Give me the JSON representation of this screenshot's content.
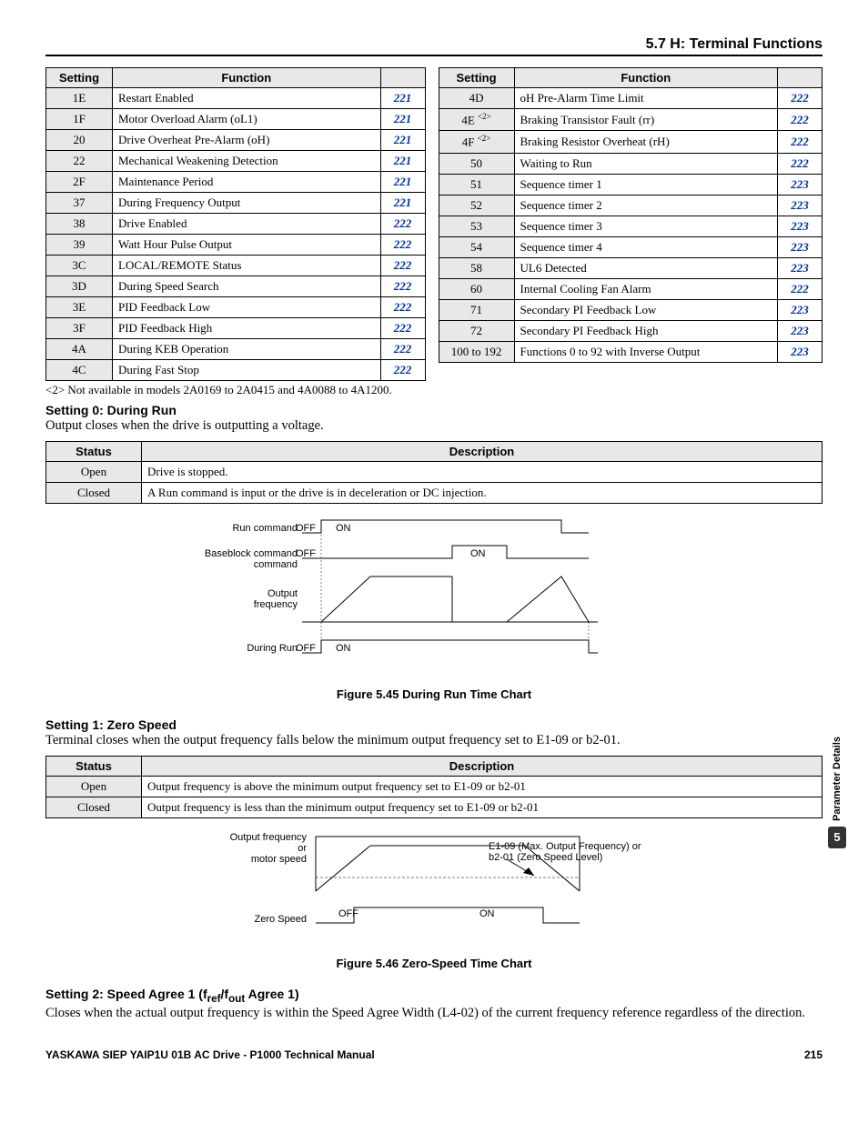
{
  "header": "5.7 H: Terminal Functions",
  "tableHeaders": {
    "setting": "Setting",
    "function": "Function"
  },
  "leftRows": [
    {
      "s": "1E",
      "f": "Restart Enabled",
      "p": "221"
    },
    {
      "s": "1F",
      "f": "Motor Overload Alarm (oL1)",
      "p": "221"
    },
    {
      "s": "20",
      "f": "Drive Overheat Pre-Alarm (oH)",
      "p": "221"
    },
    {
      "s": "22",
      "f": "Mechanical Weakening Detection",
      "p": "221"
    },
    {
      "s": "2F",
      "f": "Maintenance Period",
      "p": "221"
    },
    {
      "s": "37",
      "f": "During Frequency Output",
      "p": "221"
    },
    {
      "s": "38",
      "f": "Drive Enabled",
      "p": "222"
    },
    {
      "s": "39",
      "f": "Watt Hour Pulse Output",
      "p": "222"
    },
    {
      "s": "3C",
      "f": "LOCAL/REMOTE Status",
      "p": "222"
    },
    {
      "s": "3D",
      "f": "During Speed Search",
      "p": "222"
    },
    {
      "s": "3E",
      "f": "PID Feedback Low",
      "p": "222"
    },
    {
      "s": "3F",
      "f": "PID Feedback High",
      "p": "222"
    },
    {
      "s": "4A",
      "f": "During KEB Operation",
      "p": "222"
    },
    {
      "s": "4C",
      "f": "During Fast Stop",
      "p": "222"
    }
  ],
  "rightRows": [
    {
      "s": "4D",
      "f": "oH Pre-Alarm Time Limit",
      "p": "222"
    },
    {
      "s": "4E <2>",
      "f": "Braking Transistor Fault (rr)",
      "p": "222"
    },
    {
      "s": "4F <2>",
      "f": "Braking Resistor Overheat (rH)",
      "p": "222"
    },
    {
      "s": "50",
      "f": "Waiting to Run",
      "p": "222"
    },
    {
      "s": "51",
      "f": "Sequence timer 1",
      "p": "223"
    },
    {
      "s": "52",
      "f": "Sequence timer 2",
      "p": "223"
    },
    {
      "s": "53",
      "f": "Sequence timer 3",
      "p": "223"
    },
    {
      "s": "54",
      "f": "Sequence timer 4",
      "p": "223"
    },
    {
      "s": "58",
      "f": "UL6 Detected",
      "p": "223"
    },
    {
      "s": "60",
      "f": "Internal Cooling Fan Alarm",
      "p": "222"
    },
    {
      "s": "71",
      "f": "Secondary PI Feedback Low",
      "p": "223"
    },
    {
      "s": "72",
      "f": "Secondary PI Feedback High",
      "p": "223"
    },
    {
      "s": "100 to 192",
      "f": "Functions 0 to 92 with Inverse Output",
      "p": "223"
    }
  ],
  "footnote": "<2>   Not available in models 2A0169 to 2A0415 and 4A0088 to 4A1200.",
  "setting0": {
    "title": "Setting 0: During Run",
    "body": "Output closes when the drive is outputting a voltage.",
    "headers": {
      "status": "Status",
      "desc": "Description"
    },
    "rows": [
      {
        "status": "Open",
        "desc": "Drive is stopped."
      },
      {
        "status": "Closed",
        "desc": "A Run command is input or the drive is in deceleration or DC injection."
      }
    ],
    "figcap": "Figure 5.45  During Run Time Chart",
    "diag": {
      "run": "Run command",
      "bb": "Baseblock command",
      "of": "Output frequency",
      "dr": "During Run",
      "off": "OFF",
      "on": "ON"
    }
  },
  "setting1": {
    "title": "Setting 1: Zero Speed",
    "body": "Terminal closes when the output frequency falls below the minimum output frequency set to E1-09 or b2-01.",
    "headers": {
      "status": "Status",
      "desc": "Description"
    },
    "rows": [
      {
        "status": "Open",
        "desc": "Output frequency is above the minimum output frequency set to E1-09 or b2-01"
      },
      {
        "status": "Closed",
        "desc": "Output frequency is less than the minimum output frequency set to E1-09 or b2-01"
      }
    ],
    "figcap": "Figure 5.46  Zero-Speed Time Chart",
    "diag": {
      "top": "Output frequency or motor speed",
      "note": "E1-09 (Max. Output Frequency) or b2-01 (Zero Speed Level)",
      "zs": "Zero Speed",
      "off": "OFF",
      "on": "ON"
    }
  },
  "setting2": {
    "title_prefix": "Setting 2: Speed Agree 1 (f",
    "title_sub1": "ref",
    "title_mid": "/f",
    "title_sub2": "out",
    "title_suffix": " Agree 1)",
    "body": "Closes when the actual output frequency is within the Speed Agree Width (L4-02) of the current frequency reference regardless of the direction."
  },
  "sidetab": {
    "label": "Parameter Details",
    "num": "5"
  },
  "footer": {
    "left": "YASKAWA SIEP YAIP1U 01B AC Drive - P1000 Technical Manual",
    "right": "215"
  }
}
